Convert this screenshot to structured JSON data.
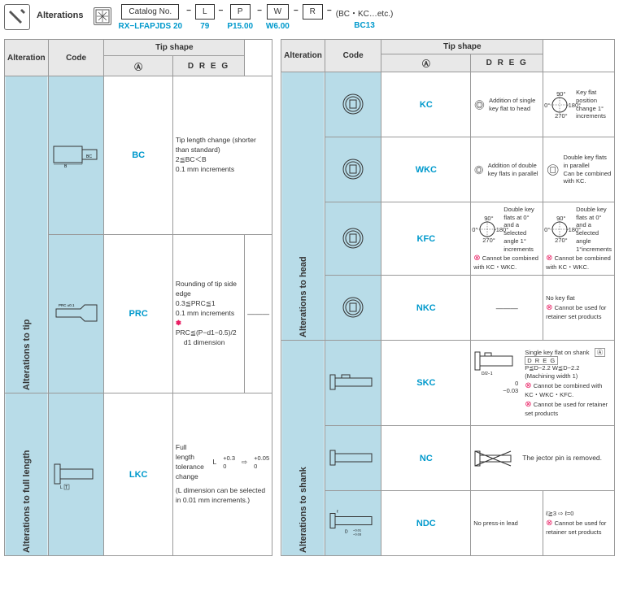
{
  "header": {
    "title": "Alterations",
    "order_label": "Catalog No.",
    "catalog_no": "RX−LFAPJDS 20",
    "L_label": "L",
    "L_val": "79",
    "P_label": "P",
    "P_val": "P15.00",
    "W_label": "W",
    "W_val": "W6.00",
    "R_label": "R",
    "suffix": "(BC・KC…etc.)",
    "suffix_val": "BC13"
  },
  "th": {
    "alteration": "Alteration",
    "code": "Code",
    "tipshape": "Tip shape",
    "a": "Ⓐ",
    "dreg": "D R E G"
  },
  "sections": {
    "tip": "Alterations to tip",
    "full": "Alterations to full length",
    "head": "Alterations to head",
    "shank": "Alterations to shank"
  },
  "rows": {
    "bc": {
      "code": "BC",
      "desc": "Tip length change (shorter than standard)\n2≦BC＜B\n0.1 mm increments"
    },
    "prc": {
      "code": "PRC",
      "l1": "Rounding of tip side edge",
      "l2": "0.3≦PRC≦1",
      "l3": "0.1 mm increments",
      "l4": "PRC≦(P−d1−0.5)/2",
      "l5": "d1 dimension",
      "dash": "———"
    },
    "lkc": {
      "code": "LKC",
      "l1": "Full length tolerance change",
      "l2": "L",
      "tol1": "+0.3",
      "tol2": "0",
      "arr": "⇨",
      "tol3": "+0.05",
      "tol4": "0",
      "l3": "(L dimension can be selected in 0.01 mm increments.)"
    },
    "kc": {
      "code": "KC",
      "a": "Addition of single key flat to head",
      "d": "Key flat position change 1° increments",
      "angles": {
        "t": "90°",
        "l": "0°",
        "r": "-180°",
        "b": "270°"
      }
    },
    "wkc": {
      "code": "WKC",
      "a": "Addition of double key flats in parallel",
      "d": "Double key flats in parallel\nCan be combined with KC."
    },
    "kfc": {
      "code": "KFC",
      "a": "Double key flats at 0° and a selected angle 1° increments",
      "d": "Double key flats at 0° and a selected angle 1°increments",
      "warn": "Cannot be combined with KC・WKC.",
      "warn2": "Cannot be combined with KC・WKC."
    },
    "nkc": {
      "code": "NKC",
      "dash": "———",
      "d": "No key flat",
      "warn": "Cannot be used for retainer set products"
    },
    "skc": {
      "code": "SKC",
      "t1": "Single key flat on shank",
      "dreg": "D R E G",
      "t3": "P≦D−2.2  W≦D−2.2",
      "t4": "(Machining width 1)",
      "warn1": "Cannot be combined with KC・WKC・KFC.",
      "warn2": "Cannot be used for retainer set products",
      "dim": "D−1",
      "tol": "0",
      "tol2": "−0.03",
      "dim2": "D",
      "dim3": "2"
    },
    "nc": {
      "code": "NC",
      "d": "The jector pin is removed."
    },
    "ndc": {
      "code": "NDC",
      "l1": "No press-in lead",
      "l2": "ℓ≧3 ⇨ ℓ=0",
      "warn": "Cannot be used for retainer set products",
      "lbl": "ℓ",
      "lbl2": "D",
      "tol1": "−0.01",
      "tol2": "−0.03"
    }
  },
  "alt_dim": {
    "bc": "BC",
    "b": "B",
    "prc": "PRC ±0.1",
    "lt": "L",
    "t": "T"
  }
}
